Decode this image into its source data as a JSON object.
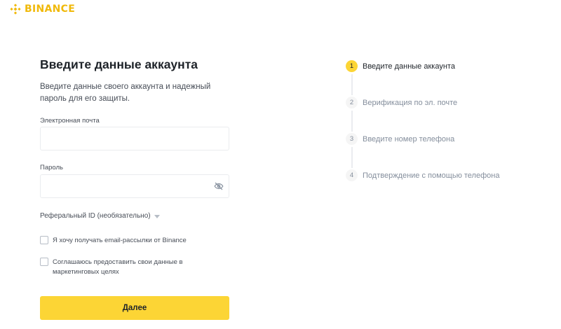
{
  "brand": {
    "name": "BINANCE",
    "accent_color": "#f0b90b",
    "logo_icon": "binance-diamond-icon"
  },
  "form": {
    "title": "Введите данные аккаунта",
    "subtitle": "Введите данные своего аккаунта и надежный пароль для его защиты.",
    "email_label": "Электронная почта",
    "email_value": "",
    "password_label": "Пароль",
    "password_value": "",
    "password_icon": "eye-slash-icon",
    "referral_label": "Реферальный ID (необязательно)",
    "checkbox_email_label": "Я хочу получать email-рассылки от Binance",
    "checkbox_email_checked": false,
    "checkbox_marketing_label": "Соглашаюсь предоставить свои данные в маркетинговых целях",
    "checkbox_marketing_checked": false,
    "submit_label": "Далее",
    "submit_color": "#fcd535"
  },
  "steps": [
    {
      "number": "1",
      "label": "Введите данные аккаунта",
      "active": true
    },
    {
      "number": "2",
      "label": "Верификация по эл. почте",
      "active": false
    },
    {
      "number": "3",
      "label": "Введите номер телефона",
      "active": false
    },
    {
      "number": "4",
      "label": "Подтверждение с помощью телефона",
      "active": false
    }
  ]
}
